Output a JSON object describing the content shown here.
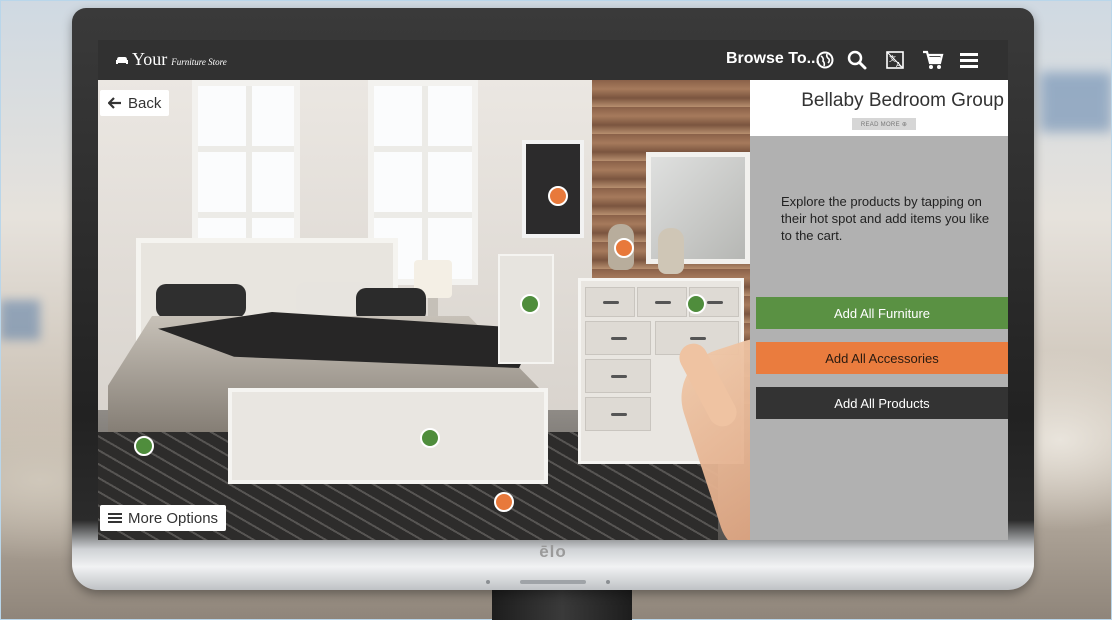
{
  "logo": {
    "icon": "sofa-icon",
    "main": "Your",
    "sub": "Furniture Store"
  },
  "topbar": {
    "browse_label": "Browse To...",
    "icons": [
      "globe-icon",
      "search-icon",
      "language-icon",
      "cart-icon",
      "menu-icon"
    ]
  },
  "room": {
    "back_label": "Back",
    "more_options_label": "More Options"
  },
  "hotspots": [
    {
      "color": "orange"
    },
    {
      "color": "orange"
    },
    {
      "color": "green"
    },
    {
      "color": "green"
    },
    {
      "color": "green"
    },
    {
      "color": "green"
    },
    {
      "color": "orange"
    }
  ],
  "panel": {
    "title": "Bellaby Bedroom Group",
    "read_more": "READ MORE ⊕",
    "description": "Explore the products by tapping on their hot spot and add items you like to the cart.",
    "buttons": {
      "furniture": "Add All Furniture",
      "accessories": "Add All Accessories",
      "products": "Add All Products"
    }
  },
  "monitor": {
    "brand": "ēlo"
  },
  "colors": {
    "green": "#5a9143",
    "orange": "#ea7c3e",
    "dark": "#333333",
    "topbar": "#313131"
  }
}
